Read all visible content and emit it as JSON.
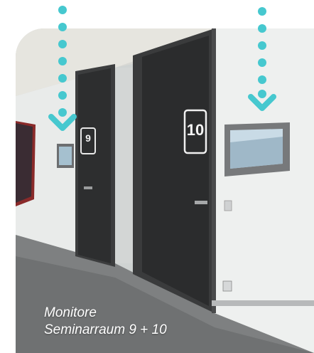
{
  "photo": {
    "door_numbers": [
      "9",
      "10"
    ]
  },
  "caption": {
    "line1": "Monitore",
    "line2": "Seminarraum 9 + 10"
  },
  "pointers": [
    {
      "name": "left-monitor-pointer",
      "icon": "dotted-arrow-down-icon"
    },
    {
      "name": "right-monitor-pointer",
      "icon": "dotted-arrow-down-icon"
    }
  ],
  "colors": {
    "accent_teal": "#46c8cf",
    "door": "#2e2f30",
    "wall": "#dfe2e1",
    "floor": "#7c7e7f"
  }
}
